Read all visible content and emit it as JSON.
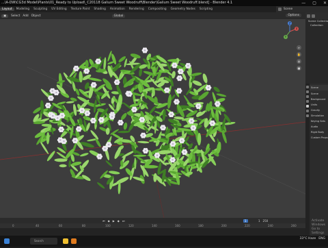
{
  "window": {
    "title": "...\\A-DW\\CG3d Model\\Plants\\01_Ready to Upload\\_C20118 Galium Sweet Woodruff\\Blender\\Galium Sweet Woodruff.blend] - Blender 4.1",
    "min": "—",
    "max": "▢",
    "close": "✕"
  },
  "workspace_tabs": [
    "Layout",
    "Modeling",
    "Sculpting",
    "UV Editing",
    "Texture Paint",
    "Shading",
    "Animation",
    "Rendering",
    "Compositing",
    "Geometry Nodes",
    "Scripting"
  ],
  "active_tab": "Layout",
  "scene_panel": {
    "label": "Scene"
  },
  "viewport_header": {
    "select": "Select",
    "add": "Add",
    "object": "Object",
    "orientation": "Global",
    "options": "Options"
  },
  "gizmo": {
    "x": "X",
    "y": "Y",
    "z": "Z"
  },
  "timeline": {
    "current_frame": "1",
    "start": "1",
    "end": "250",
    "ticks": [
      "0",
      "40",
      "60",
      "80",
      "100",
      "120",
      "140",
      "160",
      "180",
      "200",
      "220",
      "240",
      "260"
    ]
  },
  "outliner": {
    "rows": [
      "Scene Collection",
      "Collection"
    ]
  },
  "properties": {
    "header": "Scene",
    "rows": [
      "Scene",
      "Background",
      "Units",
      "Gravity",
      "Simulation",
      "Keying Sets",
      "Audio",
      "Rigid Body",
      "Custom Props"
    ]
  },
  "activation_watermark": {
    "line1": "Activate Windows",
    "line2": "Go to Settings to activate Windows."
  },
  "taskbar": {
    "search_placeholder": "Search",
    "weather": "33°C  Haze",
    "time": "ENG"
  },
  "colors": {
    "viewport_bg": "#3d3d3d",
    "leaf": "#6dbd3e",
    "leaf_dark": "#3f7f25",
    "flower": "#ece9f0",
    "accent_blue": "#3b6fb6"
  }
}
